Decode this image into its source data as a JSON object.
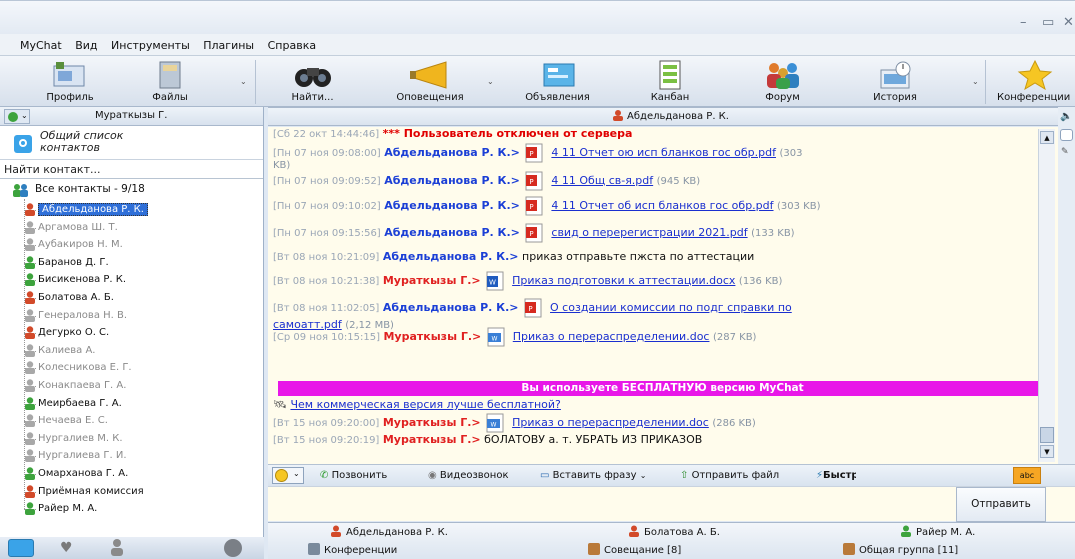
{
  "window": {
    "minimize": "–",
    "maximize": "▭",
    "close": "✕"
  },
  "menu": [
    "MyChat",
    "Вид",
    "Инструменты",
    "Плагины",
    "Справка"
  ],
  "toolbar": [
    {
      "label": "Профиль",
      "icon": "profile-icon"
    },
    {
      "label": "Файлы",
      "icon": "files-icon"
    },
    {
      "label": "Найти...",
      "icon": "binoculars-icon"
    },
    {
      "label": "Оповещения",
      "icon": "megaphone-icon"
    },
    {
      "label": "Объявления",
      "icon": "announcements-icon"
    },
    {
      "label": "Канбан",
      "icon": "kanban-icon"
    },
    {
      "label": "Форум",
      "icon": "forum-icon"
    },
    {
      "label": "История",
      "icon": "history-icon"
    },
    {
      "label": "Конференции",
      "icon": "star-icon"
    }
  ],
  "sidebar": {
    "current_user": "Мураткызы Г.",
    "general_list": "Общий список контактов",
    "search_placeholder": "Найти контакт...",
    "group_label": "Все контакты - 9/18",
    "contacts": [
      {
        "name": "Абдельданова Р. К.",
        "online": true,
        "selected": true,
        "avatar": "#d24a2a"
      },
      {
        "name": "Аргамова Ш. Т.",
        "online": false,
        "avatar": "#a8a8a8"
      },
      {
        "name": "Аубакиров Н. М.",
        "online": false,
        "avatar": "#a8a8a8"
      },
      {
        "name": "Баранов Д. Г.",
        "online": true,
        "avatar": "#3da33d"
      },
      {
        "name": "Бисикенова Р. К.",
        "online": true,
        "avatar": "#3da33d"
      },
      {
        "name": "Болатова А. Б.",
        "online": true,
        "avatar": "#d24a2a"
      },
      {
        "name": "Генералова Н. В.",
        "online": false,
        "avatar": "#a8a8a8"
      },
      {
        "name": "Дегурко О. С.",
        "online": true,
        "avatar": "#d24a2a"
      },
      {
        "name": "Калиева А.",
        "online": false,
        "avatar": "#a8a8a8"
      },
      {
        "name": "Колесникова Е. Г.",
        "online": false,
        "avatar": "#a8a8a8"
      },
      {
        "name": "Конакпаева Г. А.",
        "online": false,
        "avatar": "#a8a8a8"
      },
      {
        "name": "Меирбаева Г. А.",
        "online": true,
        "avatar": "#3da33d"
      },
      {
        "name": "Нечаева Е. С.",
        "online": false,
        "avatar": "#a8a8a8"
      },
      {
        "name": "Нургалиев М. К.",
        "online": false,
        "avatar": "#a8a8a8"
      },
      {
        "name": "Нургалиева Г. И.",
        "online": false,
        "avatar": "#a8a8a8"
      },
      {
        "name": "Омарханова Г. А.",
        "online": true,
        "avatar": "#3da33d"
      },
      {
        "name": "Приёмная комиссия",
        "online": true,
        "avatar": "#d24a2a"
      },
      {
        "name": "Райер М. А.",
        "online": true,
        "avatar": "#3da33d"
      }
    ]
  },
  "chat": {
    "header": "Абдельданова Р. К.",
    "messages": [
      {
        "ts": "[Сб 22 окт 14:44:46]",
        "system": "*** Пользователь отключен от сервера"
      },
      {
        "ts": "[Пн 07 ноя 09:08:00]",
        "author": "Абдельданова Р. К.>",
        "role": "a",
        "file": "4 11  Отчет ою исп бланков гос обр.pdf",
        "size": "(303",
        "size2": "KB)",
        "ftype": "pdf"
      },
      {
        "ts": "[Пн 07 ноя 09:09:52]",
        "author": "Абдельданова Р. К.>",
        "role": "a",
        "file": "4 11   Общ св-я.pdf",
        "size": "(945 KB)",
        "ftype": "pdf"
      },
      {
        "ts": "[Пн 07 ноя 09:10:02]",
        "author": "Абдельданова Р. К.>",
        "role": "a",
        "file": "4 11  Отчет об исп бланков гос обр.pdf",
        "size": "(303 KB)",
        "ftype": "pdf"
      },
      {
        "ts": "[Пн 07 ноя 09:15:56]",
        "author": "Абдельданова Р. К.>",
        "role": "a",
        "file": "свид о перерегистрации 2021.pdf",
        "size": "(133 KB)",
        "ftype": "pdf"
      },
      {
        "ts": "[Вт 08 ноя 10:21:09]",
        "author": "Абдельданова Р. К.>",
        "role": "a",
        "text": "приказ отправьте пжста     по аттестации"
      },
      {
        "ts": "[Вт 08 ноя 10:21:38]",
        "author": "Мураткызы Г.>",
        "role": "m",
        "file": "Приказ подготовки к аттестации.docx",
        "size": "(136 KB)",
        "ftype": "docx"
      },
      {
        "ts": "[Вт 08 ноя 11:02:05]",
        "author": "Абдельданова Р. К.>",
        "role": "a",
        "file": "О создании комиссии  по подг справки по",
        "file2": "самоатт.pdf",
        "size": "(2,12 MB)",
        "ftype": "pdf"
      },
      {
        "ts": "[Ср 09 ноя 10:15:15]",
        "author": "Мураткызы Г.>",
        "role": "m",
        "file": "Приказ о перераспределении.doc",
        "size": "(287 KB)",
        "ftype": "doc"
      },
      {
        "ts": "[Вт 15 ноя 09:20:00]",
        "author": "Мураткызы Г.>",
        "role": "m",
        "file": "Приказ о перераспределении.doc",
        "size": "(286 KB)",
        "ftype": "doc"
      },
      {
        "ts": "[Вт 15 ноя 09:20:19]",
        "author": "Мураткызы Г.>",
        "role": "m",
        "text": "бОЛАТОВУ а. т. УБРАТЬ ИЗ ПРИКАЗОВ"
      }
    ],
    "banner": "Вы используете БЕСПЛАТНУЮ версию MyChat",
    "promo_link": "Чем коммерческая версия лучше бесплатной?"
  },
  "input_toolbar": {
    "call": "Позвонить",
    "video": "Видеозвонок",
    "insert": "Вставить фразу",
    "send_file": "Отправить файл",
    "more": "Быстр"
  },
  "send_button": "Отправить",
  "tabs": {
    "row1": [
      "Абдельданова Р. К.",
      "Болатова А. Б.",
      "Райер М. А."
    ],
    "row2": [
      "Конференции",
      "Совещание [8]",
      "Общая группа [11]"
    ]
  },
  "colors": {
    "author_admin": "#1b3fd6",
    "author_me": "#e02020",
    "banner": "#e817e8"
  }
}
